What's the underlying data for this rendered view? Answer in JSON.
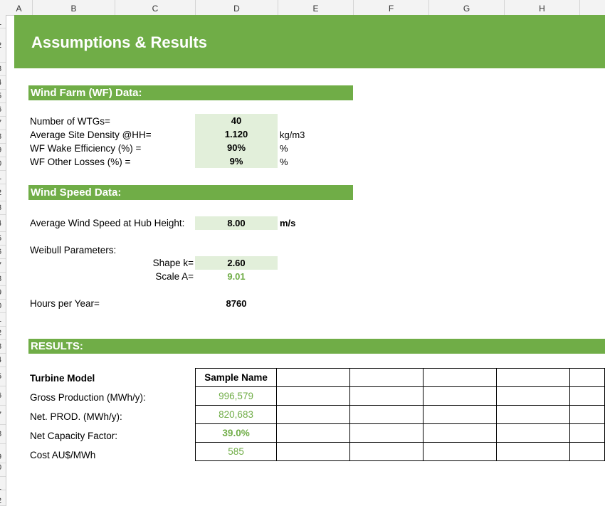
{
  "columns": [
    "A",
    "B",
    "C",
    "D",
    "E",
    "F",
    "G",
    "H"
  ],
  "rows": [
    "1",
    "2",
    "3",
    "4",
    "5",
    "6",
    "7",
    "8",
    "9",
    "0",
    "1",
    "2",
    "3",
    "4",
    "5",
    "6",
    "7",
    "8",
    "9",
    "0",
    "1",
    "2",
    "3",
    "4",
    "5",
    "6",
    "7",
    "8",
    "9",
    "0",
    "1",
    "2"
  ],
  "title": "Assumptions & Results",
  "wf": {
    "header": "Wind Farm (WF) Data:",
    "num_wtg_label": "Number of WTGs=",
    "num_wtg": "40",
    "density_label": "Average Site Density @HH=",
    "density": "1.120",
    "density_unit": "kg/m3",
    "wake_label": "WF Wake Efficiency (%) =",
    "wake": "90%",
    "wake_unit": "%",
    "losses_label": "WF Other Losses (%) =",
    "losses": "9%",
    "losses_unit": "%"
  },
  "ws": {
    "header": "Wind Speed Data:",
    "avg_label": "Average Wind Speed at Hub Height:",
    "avg": "8.00",
    "avg_unit": "m/s",
    "weibull_label": "Weibull Parameters:",
    "shape_label": "Shape k=",
    "shape": "2.60",
    "scale_label": "Scale A=",
    "scale": "9.01",
    "hours_label": "Hours per Year=",
    "hours": "8760"
  },
  "results": {
    "header": "RESULTS:",
    "model_label": "Turbine Model",
    "model_name": "Sample Name",
    "gross_label": "Gross Production (MWh/y):",
    "gross": "996,579",
    "net_label": "Net. PROD. (MWh/y):",
    "net": "820,683",
    "ncf_label": "Net Capacity Factor:",
    "ncf": "39.0%",
    "cost_label": "Cost AU$/MWh",
    "cost": "585"
  }
}
